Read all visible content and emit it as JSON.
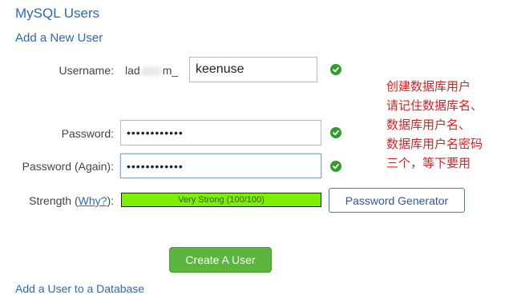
{
  "page": {
    "title": "MySQL Users",
    "add_user_heading": "Add a New User",
    "add_to_db_link": "Add a User to a Database"
  },
  "form": {
    "username_label": "Username:",
    "username_prefix_start": "lad",
    "username_prefix_end": "m_",
    "username_value": "keenuse",
    "password_label": "Password:",
    "password_value": "••••••••••••",
    "password_again_label": "Password (Again):",
    "password_again_value": "••••••••••••",
    "strength_label_start": "Strength (",
    "strength_why_link": "Why?",
    "strength_label_end": "):",
    "strength_text": "Very Strong (100/100)",
    "strength_percent": 100,
    "password_generator_button": "Password Generator",
    "create_button": "Create A User"
  },
  "annotation": {
    "lines": [
      "创建数据库用户",
      "请记住数据库名、",
      "数据库用户名、",
      "数据库用户名密码",
      "三个，等下要用"
    ]
  },
  "colors": {
    "link": "#2a6ab8",
    "valid_check": "#2f9e2f",
    "strength_fill": "#7cf000",
    "create_button": "#5cb53e",
    "annotation": "#e02020"
  },
  "icons": {
    "valid": "check-circle-icon"
  }
}
